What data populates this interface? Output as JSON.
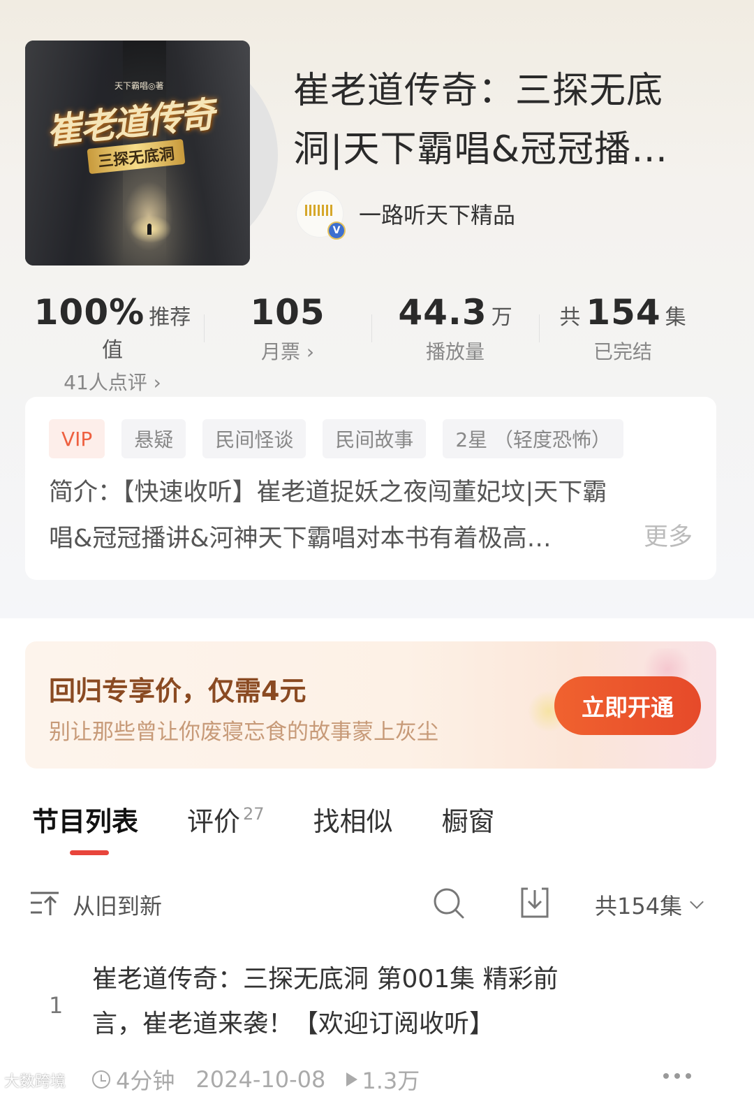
{
  "cover": {
    "author_text": "天下霸唱◎著",
    "title_text": "崔老道传奇",
    "subtitle_text": "三探无底洞"
  },
  "book": {
    "title_line1": "崔老道传奇：三探无底",
    "title_line2": "洞|天下霸唱&冠冠播…",
    "publisher": "一路听天下精品"
  },
  "stats": {
    "recommend_value": "100%",
    "recommend_label": "推荐值",
    "reviews_link": "41人点评 ›",
    "monthly_tickets": "105",
    "monthly_tickets_link": "月票 ›",
    "plays_value": "44.3",
    "plays_unit": "万",
    "plays_label": "播放量",
    "episodes_prefix": "共",
    "episodes_value": "154",
    "episodes_unit": "集",
    "status": "已完结"
  },
  "tags": [
    "VIP",
    "悬疑",
    "民间怪谈",
    "民间故事",
    "2星 （轻度恐怖）"
  ],
  "intro": {
    "line1": "简介：【快速收听】崔老道捉妖之夜闯董妃坟|天下霸",
    "line2": "唱&冠冠播讲&河神天下霸唱对本书有着极高…",
    "more": "更多"
  },
  "promo": {
    "title": "回归专享价，仅需4元",
    "subtitle": "别让那些曾让你废寝忘食的故事蒙上灰尘",
    "button": "立即开通"
  },
  "tabs": {
    "programs": "节目列表",
    "reviews": "评价",
    "reviews_count": "27",
    "similar": "找相似",
    "showcase": "橱窗"
  },
  "toolbar": {
    "sort": "从旧到新",
    "total": "共154集"
  },
  "episode": {
    "number": "1",
    "title_line1": "崔老道传奇：三探无底洞 第001集 精彩前",
    "title_line2": "言，崔老道来袭！【欢迎订阅收听】",
    "duration": "4分钟",
    "date": "2024-10-08",
    "plays": "1.3万"
  },
  "watermark": "大数跨境",
  "colors": {
    "accent_red": "#e8453c",
    "promo_button": "#f0622f",
    "vip_tag": "#ee6040"
  }
}
